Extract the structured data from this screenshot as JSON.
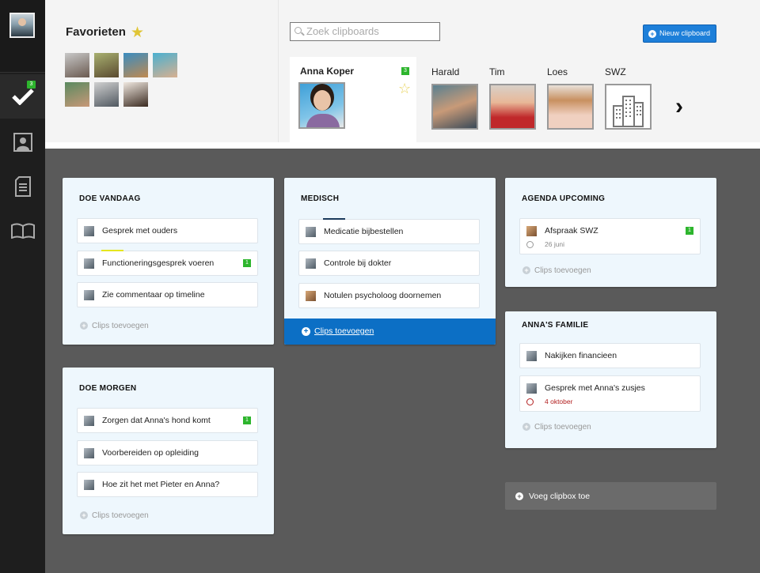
{
  "sidebar": {
    "badge": "3",
    "items": [
      "checklist-icon",
      "contacts-icon",
      "document-icon",
      "book-icon"
    ]
  },
  "favorites": {
    "title": "Favorieten"
  },
  "search": {
    "placeholder": "Zoek clipboards"
  },
  "new_clipboard_label": "Nieuw clipboard",
  "active_person": {
    "name": "Anna Koper",
    "badge": "3"
  },
  "people": [
    {
      "name": "Harald"
    },
    {
      "name": "Tim"
    },
    {
      "name": "Loes"
    },
    {
      "name": "SWZ"
    }
  ],
  "boards": {
    "doe_vandaag": {
      "title": "DOE VANDAAG",
      "clips": [
        {
          "text": "Gesprek met ouders"
        },
        {
          "text": "Functioneringsgesprek voeren",
          "badge": "1"
        },
        {
          "text": "Zie commentaar op timeline"
        }
      ],
      "add_label": "Clips toevoegen"
    },
    "doe_morgen": {
      "title": "DOE MORGEN",
      "clips": [
        {
          "text": "Zorgen dat Anna's hond komt",
          "badge": "1"
        },
        {
          "text": "Voorbereiden op opleiding"
        },
        {
          "text": "Hoe zit het met Pieter en Anna?"
        }
      ],
      "add_label": "Clips toevoegen"
    },
    "medisch": {
      "title": "MEDISCH",
      "clips": [
        {
          "text": "Medicatie bijbestellen"
        },
        {
          "text": "Controle bij dokter"
        },
        {
          "text": "Notulen psycholoog doornemen"
        }
      ],
      "add_label": "Clips toevoegen"
    },
    "agenda": {
      "title": "AGENDA UPCOMING",
      "clips": [
        {
          "text": "Afspraak SWZ",
          "badge": "1",
          "date": "26 juni"
        }
      ],
      "add_label": "Clips toevoegen"
    },
    "familie": {
      "title": "ANNA'S FAMILIE",
      "clips": [
        {
          "text": "Nakijken financieen"
        },
        {
          "text": "Gesprek met Anna's zusjes",
          "date": "4 oktober"
        }
      ],
      "add_label": "Clips toevoegen"
    }
  },
  "add_clipbox_label": "Voeg clipbox toe",
  "colors": {
    "accent": "#1d7fd9",
    "badge": "#2db52d",
    "sidebar": "#1e1e1e",
    "date_red": "#b21e1e"
  }
}
